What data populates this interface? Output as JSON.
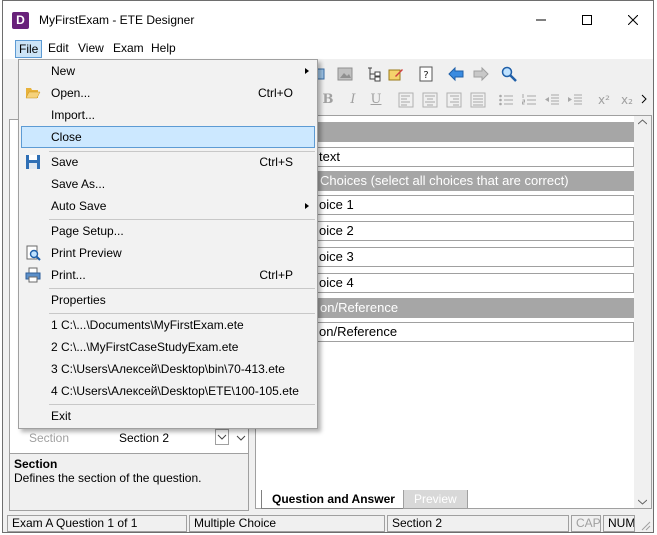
{
  "window": {
    "title": "MyFirstExam - ETE Designer",
    "app_icon_letter": "D",
    "accent": "#68217a"
  },
  "menubar": {
    "items": [
      "File",
      "Edit",
      "View",
      "Exam",
      "Help"
    ]
  },
  "file_menu": {
    "new": "New",
    "open": "Open...",
    "open_shortcut": "Ctrl+O",
    "import": "Import...",
    "close": "Close",
    "save": "Save",
    "save_shortcut": "Ctrl+S",
    "save_as": "Save As...",
    "auto_save": "Auto Save",
    "page_setup": "Page Setup...",
    "print_preview": "Print Preview",
    "print": "Print...",
    "print_shortcut": "Ctrl+P",
    "properties": "Properties",
    "recent": [
      "1 C:\\...\\Documents\\MyFirstExam.ete",
      "2 C:\\...\\MyFirstCaseStudyExam.ete",
      "3 C:\\Users\\Алексей\\Desktop\\bin\\70-413.ete",
      "4 C:\\Users\\Алексей\\Desktop\\ETE\\100-105.ete"
    ],
    "exit": "Exit"
  },
  "format_toolbar": {
    "bold": "B",
    "italic": "I",
    "underline": "U",
    "superscript": "x²",
    "subscript": "x₂"
  },
  "properties": {
    "row_name": "Section",
    "row_value": "Section 2",
    "description_title": "Section",
    "description_text": "Defines the section of the question."
  },
  "editor": {
    "question_text": "text",
    "choices_header": "Choices (select all choices that are correct)",
    "choices": [
      "oice 1",
      "oice 2",
      "oice 3",
      "oice 4"
    ],
    "explanation_header": "on/Reference",
    "explanation_field": "on/Reference"
  },
  "tabs": {
    "active": "Question and Answer",
    "inactive": "Preview"
  },
  "statusbar": {
    "exam": "Exam A   Question 1 of 1",
    "type": "Multiple Choice",
    "section": "Section 2",
    "caps": "CAP",
    "num": "NUM"
  }
}
